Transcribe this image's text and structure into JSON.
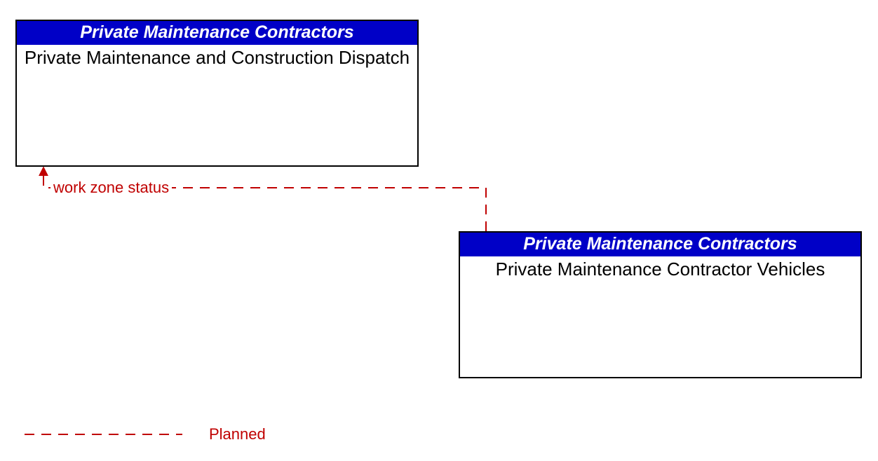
{
  "boxes": {
    "topLeft": {
      "header": "Private Maintenance Contractors",
      "body": "Private Maintenance and Construction Dispatch"
    },
    "bottomRight": {
      "header": "Private Maintenance Contractors",
      "body": "Private Maintenance Contractor Vehicles"
    }
  },
  "flow": {
    "label": "work zone status"
  },
  "legend": {
    "status": "Planned"
  },
  "colors": {
    "headerBg": "#0000c7",
    "planned": "#c00000"
  }
}
